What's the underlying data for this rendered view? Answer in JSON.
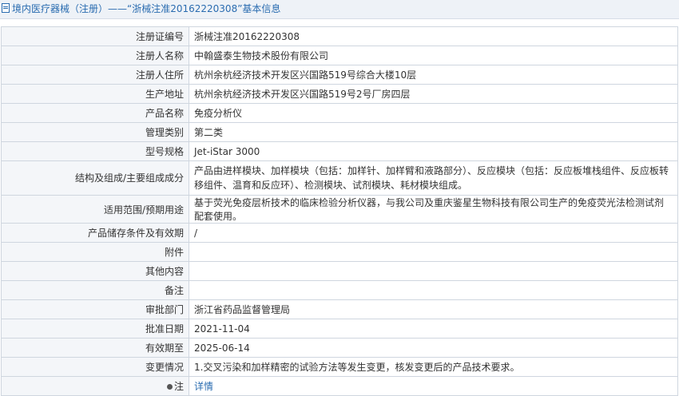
{
  "header": {
    "title": "境内医疗器械（注册）——“浙械注准20162220308”基本信息"
  },
  "rows": [
    {
      "label": "注册证编号",
      "value": "浙械注准20162220308"
    },
    {
      "label": "注册人名称",
      "value": "中翰盛泰生物技术股份有限公司"
    },
    {
      "label": "注册人住所",
      "value": "杭州余杭经济技术开发区兴国路519号综合大楼10层"
    },
    {
      "label": "生产地址",
      "value": "杭州余杭经济技术开发区兴国路519号2号厂房四层"
    },
    {
      "label": "产品名称",
      "value": "免疫分析仪"
    },
    {
      "label": "管理类别",
      "value": "第二类"
    },
    {
      "label": "型号规格",
      "value": "Jet-iStar 3000"
    },
    {
      "label": "结构及组成/主要组成成分",
      "value": "产品由进样模块、加样模块（包括：加样针、加样臂和液路部分）、反应模块（包括：反应板堆栈组件、反应板转移组件、温育和反应环）、检测模块、试剂模块、耗材模块组成。"
    },
    {
      "label": "适用范围/预期用途",
      "value": "基于荧光免疫层析技术的临床检验分析仪器，与我公司及重庆鉴星生物科技有限公司生产的免疫荧光法检测试剂配套使用。"
    },
    {
      "label": "产品储存条件及有效期",
      "value": "/"
    },
    {
      "label": "附件",
      "value": ""
    },
    {
      "label": "其他内容",
      "value": ""
    },
    {
      "label": "备注",
      "value": ""
    },
    {
      "label": "审批部门",
      "value": "浙江省药品监督管理局"
    },
    {
      "label": "批准日期",
      "value": "2021-11-04"
    },
    {
      "label": "有效期至",
      "value": "2025-06-14"
    },
    {
      "label": "变更情况",
      "value": "1.交叉污染和加样精密的试验方法等发生变更，核发变更后的产品技术要求。"
    }
  ],
  "note_row": {
    "label": "注",
    "link_text": "详情",
    "icon": "info-dot-icon"
  }
}
